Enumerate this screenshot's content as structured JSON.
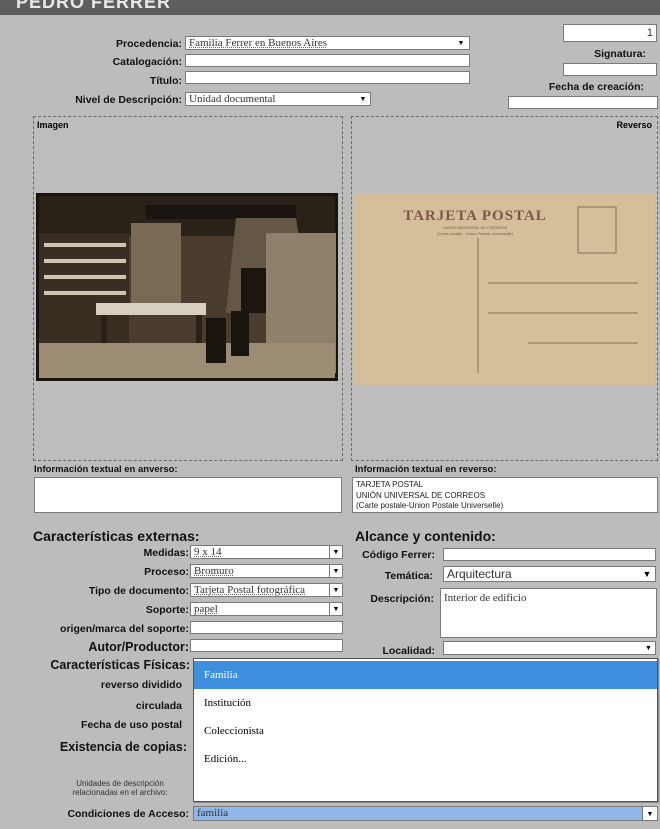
{
  "header": {
    "title": "PEDRO FERRER"
  },
  "form": {
    "procedencia": {
      "label": "Procedencia:",
      "value": "Familia Ferrer en Buenos Aires"
    },
    "catalogacion": {
      "label": "Catalogación:",
      "value": ""
    },
    "titulo": {
      "label": "Título:",
      "value": ""
    },
    "nivel": {
      "label": "Nivel de Descripción:",
      "value": "Unidad documental"
    },
    "number": {
      "value": "1"
    },
    "signatura": {
      "label": "Signatura:",
      "value": ""
    },
    "fecha_creacion": {
      "label": "Fecha de creación:",
      "value": ""
    }
  },
  "images": {
    "front_caption": "Imagen",
    "back_caption": "Reverso",
    "postcard": {
      "title": "TARJETA POSTAL",
      "line1": "UNION UNIVERSAL DE CORREOS",
      "line2": "(Carte postale - Union Postale Universelle)"
    }
  },
  "text_info": {
    "front_label": "Información textual en anverso:",
    "front_value": "",
    "back_label": "Información textual en reverso:",
    "back_lines": [
      "TARJETA POSTAL",
      "UNIÓN UNIVERSAL DE CORREOS",
      "(Carte postale-Union Postale Universelle)"
    ]
  },
  "externas": {
    "heading": "Características externas:",
    "medidas": {
      "label": "Medidas:",
      "value": "9 x 14"
    },
    "proceso": {
      "label": "Proceso:",
      "value": "Bromuro"
    },
    "tipo_doc": {
      "label": "Tipo de documento:",
      "value": "Tarjeta Postal fotográfica"
    },
    "soporte": {
      "label": "Soporte:",
      "value": "papel"
    },
    "origen": {
      "label": "origen/marca del soporte:",
      "value": ""
    },
    "autor": {
      "label": "Autor/Productor:",
      "value": ""
    },
    "fisicas": {
      "label": "Características Físicas:"
    },
    "reverso": {
      "label": "reverso dividido"
    },
    "circulada": {
      "label": "circulada"
    },
    "fecha_uso": {
      "label": "Fecha de uso postal"
    },
    "copias": {
      "label": "Existencia de copias:"
    },
    "unidades": {
      "line1": "Unidades de descripción",
      "line2": "relacionadas en el archivo:"
    },
    "condiciones": {
      "label": "Condiciones de Acceso:",
      "value": "familia"
    }
  },
  "alcance": {
    "heading": "Alcance y contenido:",
    "codigo": {
      "label": "Código Ferrer:",
      "value": ""
    },
    "tematica": {
      "label": "Temática:",
      "value": "Arquitectura"
    },
    "descripcion": {
      "label": "Descripción:",
      "value": "Interior de edificio"
    },
    "localidad": {
      "label": "Localidad:",
      "value": ""
    }
  },
  "popup": {
    "options": [
      "Familia",
      "Institución",
      "Coleccionista",
      "Edición..."
    ],
    "selected_index": 0
  }
}
